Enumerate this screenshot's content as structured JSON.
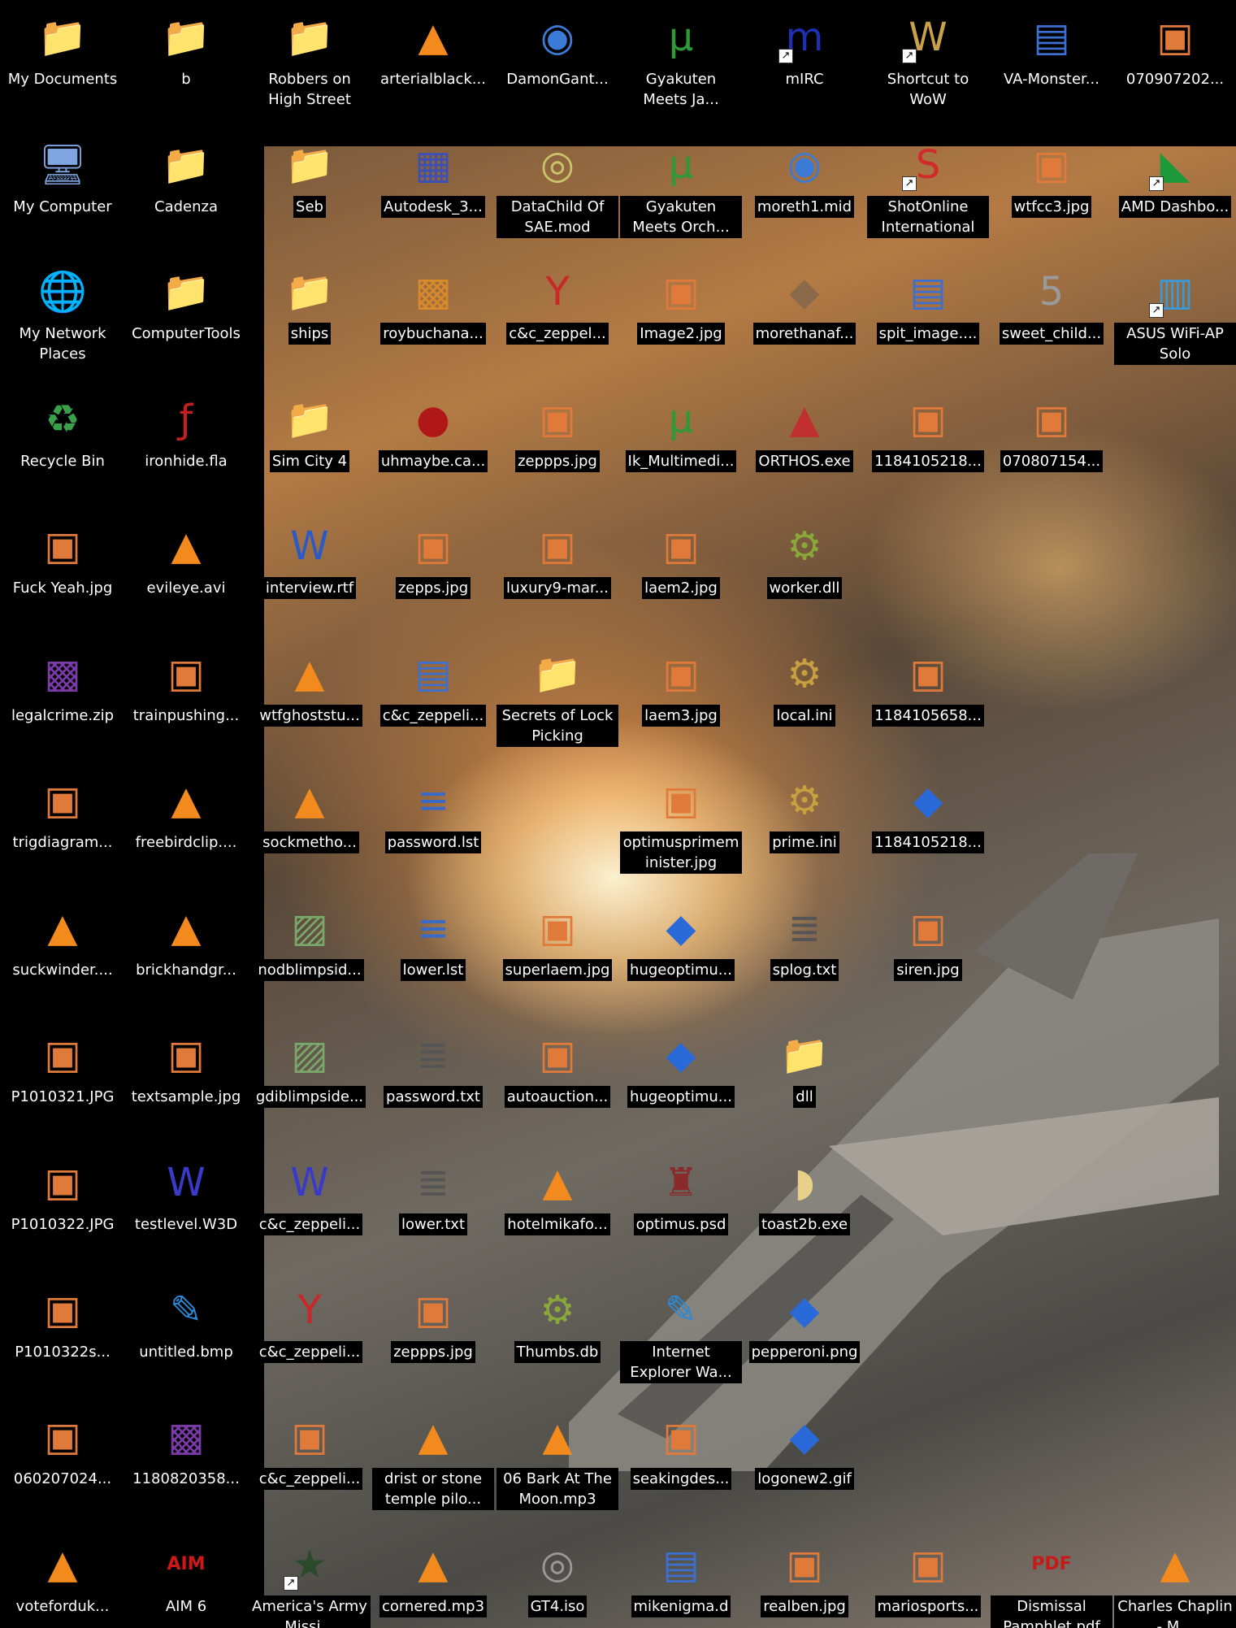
{
  "desktop": {
    "icons": [
      {
        "label": "My Documents",
        "icon": "my-documents-icon",
        "glyph": "📁",
        "color": "#7fb3f0"
      },
      {
        "label": "b",
        "icon": "folder-icon",
        "glyph": "📁",
        "color": "#f2d36b"
      },
      {
        "label": "Robbers on High Street",
        "icon": "folder-icon",
        "glyph": "📁",
        "color": "#f2d36b"
      },
      {
        "label": "arterialblack...",
        "icon": "vlc-cone-icon",
        "glyph": "▲",
        "color": "#f28a1d"
      },
      {
        "label": "DamonGant...",
        "icon": "media-file-icon",
        "glyph": "◉",
        "color": "#3b7bd6"
      },
      {
        "label": "Gyakuten Meets Ja...",
        "icon": "torrent-file-icon",
        "glyph": "μ",
        "color": "#2d9a36"
      },
      {
        "label": "mIRC",
        "icon": "mirc-icon",
        "glyph": "m",
        "color": "#1d2fb3",
        "shortcut": true
      },
      {
        "label": "Shortcut to WoW",
        "icon": "wow-icon",
        "glyph": "W",
        "color": "#c9a14a",
        "shortcut": true
      },
      {
        "label": "VA-Monster...",
        "icon": "web-page-icon",
        "glyph": "▤",
        "color": "#3d6fd0"
      },
      {
        "label": "070907202...",
        "icon": "image-file-icon",
        "glyph": "▣",
        "color": "#e07a3a"
      },
      {
        "label": "My Computer",
        "icon": "my-computer-icon",
        "glyph": "🖥",
        "color": "#7fa6e0"
      },
      {
        "label": "Cadenza",
        "icon": "folder-icon",
        "glyph": "📁",
        "color": "#f2d36b"
      },
      {
        "label": "Seb",
        "icon": "shared-folder-icon",
        "glyph": "📁",
        "color": "#f2d36b"
      },
      {
        "label": "Autodesk_3...",
        "icon": "autodesk-icon",
        "glyph": "▦",
        "color": "#3a4fb8"
      },
      {
        "label": "DataChild Of SAE.mod",
        "icon": "media-disc-icon",
        "glyph": "◎",
        "color": "#c9c46a"
      },
      {
        "label": "Gyakuten Meets Orch...",
        "icon": "torrent-file-icon",
        "glyph": "μ",
        "color": "#2d9a36"
      },
      {
        "label": "moreth1.mid",
        "icon": "media-file-icon",
        "glyph": "◉",
        "color": "#3b7bd6"
      },
      {
        "label": "ShotOnline International",
        "icon": "shotonline-icon",
        "glyph": "S",
        "color": "#d02a2a",
        "shortcut": true
      },
      {
        "label": "wtfcc3.jpg",
        "icon": "image-file-icon",
        "glyph": "▣",
        "color": "#e07a3a"
      },
      {
        "label": "AMD Dashbo...",
        "icon": "amd-icon",
        "glyph": "◣",
        "color": "#1f9a3a",
        "shortcut": true
      },
      {
        "label": "My Network Places",
        "icon": "network-places-icon",
        "glyph": "🌐",
        "color": "#4aa0e0"
      },
      {
        "label": "ComputerTools",
        "icon": "folder-icon",
        "glyph": "📁",
        "color": "#f2d36b"
      },
      {
        "label": "ships",
        "icon": "folder-icon",
        "glyph": "📁",
        "color": "#f2d36b"
      },
      {
        "label": "roybuchana...",
        "icon": "rar-archive-icon",
        "glyph": "▩",
        "color": "#d88a2a"
      },
      {
        "label": "c&c_zeppel...",
        "icon": "y-app-icon",
        "glyph": "Y",
        "color": "#c82828"
      },
      {
        "label": "Image2.jpg",
        "icon": "image-file-icon",
        "glyph": "▣",
        "color": "#e07a3a"
      },
      {
        "label": "morethanaf...",
        "icon": "rns-file-icon",
        "glyph": "◆",
        "color": "#8a6a4a"
      },
      {
        "label": "spit_image....",
        "icon": "web-page-icon",
        "glyph": "▤",
        "color": "#3d6fd0"
      },
      {
        "label": "sweet_child...",
        "icon": "movie-file-icon",
        "glyph": "5",
        "color": "#9a9a9a"
      },
      {
        "label": "ASUS WiFi-AP Solo",
        "icon": "asus-wifi-icon",
        "glyph": "▥",
        "color": "#3a9ad8",
        "shortcut": true
      },
      {
        "label": "Recycle Bin",
        "icon": "recycle-bin-icon",
        "glyph": "♻",
        "color": "#3aa04a"
      },
      {
        "label": "ironhide.fla",
        "icon": "flash-file-icon",
        "glyph": "ƒ",
        "color": "#c22020"
      },
      {
        "label": "Sim City 4",
        "icon": "folder-icon",
        "glyph": "📁",
        "color": "#f2d36b"
      },
      {
        "label": "uhmaybe.ca...",
        "icon": "video-capture-icon",
        "glyph": "●",
        "color": "#b01818"
      },
      {
        "label": "zeppps.jpg",
        "icon": "image-file-icon",
        "glyph": "▣",
        "color": "#e07a3a"
      },
      {
        "label": "Ik_Multimedi...",
        "icon": "torrent-file-icon",
        "glyph": "μ",
        "color": "#2d9a36"
      },
      {
        "label": "ORTHOS.exe",
        "icon": "orthos-volcano-icon",
        "glyph": "▲",
        "color": "#c03030"
      },
      {
        "label": "1184105218...",
        "icon": "image-file-icon",
        "glyph": "▣",
        "color": "#e07a3a"
      },
      {
        "label": "070807154...",
        "icon": "image-file-icon",
        "glyph": "▣",
        "color": "#e07a3a"
      },
      {
        "label": "Fuck Yeah.jpg",
        "icon": "image-file-icon",
        "glyph": "▣",
        "color": "#e07a3a"
      },
      {
        "label": "evileye.avi",
        "icon": "vlc-cone-icon",
        "glyph": "▲",
        "color": "#f28a1d"
      },
      {
        "label": "interview.rtf",
        "icon": "word-document-icon",
        "glyph": "W",
        "color": "#2a5ac8"
      },
      {
        "label": "zepps.jpg",
        "icon": "image-file-icon",
        "glyph": "▣",
        "color": "#e07a3a"
      },
      {
        "label": "luxury9-mar...",
        "icon": "image-file-icon",
        "glyph": "▣",
        "color": "#e07a3a"
      },
      {
        "label": "laem2.jpg",
        "icon": "image-file-icon",
        "glyph": "▣",
        "color": "#e07a3a"
      },
      {
        "label": "worker.dll",
        "icon": "dll-gear-icon",
        "glyph": "⚙",
        "color": "#8aa83a"
      },
      {
        "label": "legalcrime.zip",
        "icon": "zip-archive-icon",
        "glyph": "▩",
        "color": "#7a3aa8"
      },
      {
        "label": "trainpushing...",
        "icon": "image-file-icon",
        "glyph": "▣",
        "color": "#e07a3a"
      },
      {
        "label": "wtfghoststu...",
        "icon": "vlc-cone-icon",
        "glyph": "▲",
        "color": "#f28a1d"
      },
      {
        "label": "c&c_zeppeli...",
        "icon": "web-page-icon",
        "glyph": "▤",
        "color": "#3d6fd0"
      },
      {
        "label": "Secrets of Lock Picking",
        "icon": "folder-icon",
        "glyph": "📁",
        "color": "#f2d36b"
      },
      {
        "label": "laem3.jpg",
        "icon": "image-file-icon",
        "glyph": "▣",
        "color": "#e07a3a"
      },
      {
        "label": "local.ini",
        "icon": "ini-settings-icon",
        "glyph": "⚙",
        "color": "#c8a040"
      },
      {
        "label": "1184105658...",
        "icon": "image-file-icon",
        "glyph": "▣",
        "color": "#e07a3a"
      },
      {
        "label": "trigdiagram...",
        "icon": "image-file-icon",
        "glyph": "▣",
        "color": "#e07a3a"
      },
      {
        "label": "freebirdclip....",
        "icon": "vlc-cone-icon",
        "glyph": "▲",
        "color": "#f28a1d"
      },
      {
        "label": "sockmetho...",
        "icon": "vlc-cone-icon",
        "glyph": "▲",
        "color": "#f28a1d"
      },
      {
        "label": "password.lst",
        "icon": "text-list-icon",
        "glyph": "≡",
        "color": "#3a6ac8"
      },
      {
        "label": "optimusprimem inister.jpg",
        "icon": "image-file-icon",
        "glyph": "▣",
        "color": "#e07a3a"
      },
      {
        "label": "prime.ini",
        "icon": "ini-settings-icon",
        "glyph": "⚙",
        "color": "#c8a040"
      },
      {
        "label": "1184105218...",
        "icon": "picture-file-icon",
        "glyph": "◆",
        "color": "#2a6ad8"
      },
      {
        "label": "suckwinder....",
        "icon": "vlc-cone-icon",
        "glyph": "▲",
        "color": "#f28a1d"
      },
      {
        "label": "brickhandgr...",
        "icon": "vlc-cone-icon",
        "glyph": "▲",
        "color": "#f28a1d"
      },
      {
        "label": "nodblimpsid...",
        "icon": "image-preview-icon",
        "glyph": "▨",
        "color": "#7aa86a"
      },
      {
        "label": "lower.lst",
        "icon": "text-list-icon",
        "glyph": "≡",
        "color": "#3a6ac8"
      },
      {
        "label": "superlaem.jpg",
        "icon": "image-file-icon",
        "glyph": "▣",
        "color": "#e07a3a"
      },
      {
        "label": "hugeoptimu...",
        "icon": "picture-file-icon",
        "glyph": "◆",
        "color": "#2a6ad8"
      },
      {
        "label": "splog.txt",
        "icon": "notepad-file-icon",
        "glyph": "≣",
        "color": "#555555"
      },
      {
        "label": "siren.jpg",
        "icon": "image-file-icon",
        "glyph": "▣",
        "color": "#e07a3a"
      },
      {
        "label": "P1010321.JPG",
        "icon": "image-file-icon",
        "glyph": "▣",
        "color": "#e07a3a"
      },
      {
        "label": "textsample.jpg",
        "icon": "image-file-icon",
        "glyph": "▣",
        "color": "#e07a3a"
      },
      {
        "label": "gdiblimpside...",
        "icon": "image-preview-icon",
        "glyph": "▨",
        "color": "#7aa86a"
      },
      {
        "label": "password.txt",
        "icon": "notepad-file-icon",
        "glyph": "≣",
        "color": "#555555"
      },
      {
        "label": "autoauction...",
        "icon": "image-file-icon",
        "glyph": "▣",
        "color": "#e07a3a"
      },
      {
        "label": "hugeoptimu...",
        "icon": "picture-file-icon",
        "glyph": "◆",
        "color": "#2a6ad8"
      },
      {
        "label": "dll",
        "icon": "folder-icon",
        "glyph": "📁",
        "color": "#f2d36b"
      },
      {
        "label": "P1010322.JPG",
        "icon": "image-file-icon",
        "glyph": "▣",
        "color": "#e07a3a"
      },
      {
        "label": "testlevel.W3D",
        "icon": "w3d-file-icon",
        "glyph": "W",
        "color": "#3a3ac8"
      },
      {
        "label": "c&c_zeppeli...",
        "icon": "w3d-file-icon",
        "glyph": "W",
        "color": "#3a3ac8"
      },
      {
        "label": "lower.txt",
        "icon": "notepad-file-icon",
        "glyph": "≣",
        "color": "#555555"
      },
      {
        "label": "hotelmikafo...",
        "icon": "vlc-cone-icon",
        "glyph": "▲",
        "color": "#f28a1d"
      },
      {
        "label": "optimus.psd",
        "icon": "psd-robot-icon",
        "glyph": "♜",
        "color": "#8a2a2a"
      },
      {
        "label": "toast2b.exe",
        "icon": "toast-app-icon",
        "glyph": "◗",
        "color": "#e8d08a"
      },
      {
        "label": "P1010322s...",
        "icon": "image-file-icon",
        "glyph": "▣",
        "color": "#e07a3a"
      },
      {
        "label": "untitled.bmp",
        "icon": "paint-brush-icon",
        "glyph": "✎",
        "color": "#2a8ad8"
      },
      {
        "label": "c&c_zeppeli...",
        "icon": "y-app-icon",
        "glyph": "Y",
        "color": "#c82828"
      },
      {
        "label": "zeppps.jpg",
        "icon": "image-file-icon",
        "glyph": "▣",
        "color": "#e07a3a"
      },
      {
        "label": "Thumbs.db",
        "icon": "thumbs-db-icon",
        "glyph": "⚙",
        "color": "#8aa83a"
      },
      {
        "label": "Internet Explorer Wa...",
        "icon": "paint-brush-icon",
        "glyph": "✎",
        "color": "#2a8ad8"
      },
      {
        "label": "pepperoni.png",
        "icon": "picture-file-icon",
        "glyph": "◆",
        "color": "#2a6ad8"
      },
      {
        "label": "060207024...",
        "icon": "image-file-icon",
        "glyph": "▣",
        "color": "#e07a3a"
      },
      {
        "label": "1180820358...",
        "icon": "rar-archive-icon",
        "glyph": "▩",
        "color": "#7a3aa8"
      },
      {
        "label": "c&c_zeppeli...",
        "icon": "image-file-icon",
        "glyph": "▣",
        "color": "#e07a3a"
      },
      {
        "label": "drist or stone temple pilo...",
        "icon": "vlc-cone-icon",
        "glyph": "▲",
        "color": "#f28a1d"
      },
      {
        "label": "06 Bark At The Moon.mp3",
        "icon": "vlc-cone-icon",
        "glyph": "▲",
        "color": "#f28a1d"
      },
      {
        "label": "seakingdes...",
        "icon": "image-file-icon",
        "glyph": "▣",
        "color": "#e07a3a"
      },
      {
        "label": "logonew2.gif",
        "icon": "picture-file-icon",
        "glyph": "◆",
        "color": "#2a6ad8"
      },
      {
        "label": "voteforduk...",
        "icon": "vlc-cone-icon",
        "glyph": "▲",
        "color": "#f28a1d"
      },
      {
        "label": "AIM 6",
        "icon": "aim-icon",
        "glyph": "AIM",
        "color": "#d01818"
      },
      {
        "label": "America's Army Missi...",
        "icon": "americas-army-icon",
        "glyph": "★",
        "color": "#2a4a2a",
        "shortcut": true
      },
      {
        "label": "cornered.mp3",
        "icon": "vlc-cone-icon",
        "glyph": "▲",
        "color": "#f28a1d"
      },
      {
        "label": "GT4.iso",
        "icon": "disc-image-icon",
        "glyph": "◎",
        "color": "#9a9a9a"
      },
      {
        "label": "mikenigma.d",
        "icon": "web-page-icon",
        "glyph": "▤",
        "color": "#3d6fd0"
      },
      {
        "label": "realben.jpg",
        "icon": "image-file-icon",
        "glyph": "▣",
        "color": "#e07a3a"
      },
      {
        "label": "mariosports...",
        "icon": "image-file-icon",
        "glyph": "▣",
        "color": "#e07a3a"
      },
      {
        "label": "Dismissal Pamphlet.pdf",
        "icon": "pdf-file-icon",
        "glyph": "PDF",
        "color": "#c81818"
      },
      {
        "label": "Charles Chaplin - M...",
        "icon": "vlc-cone-icon",
        "glyph": "▲",
        "color": "#f28a1d"
      }
    ]
  }
}
